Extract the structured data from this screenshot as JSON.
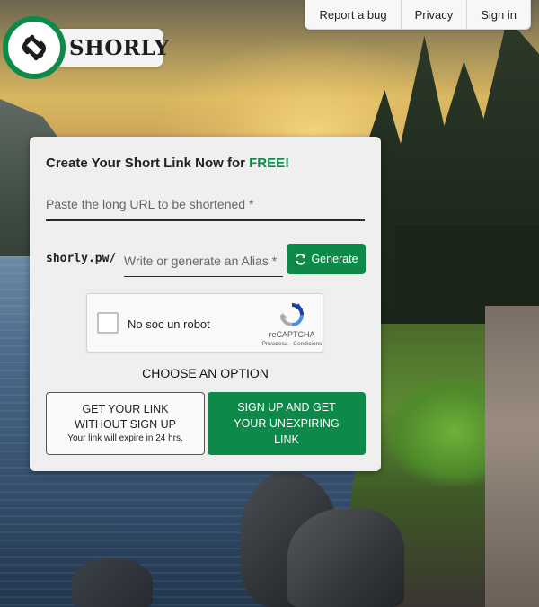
{
  "nav": {
    "report_bug": "Report a bug",
    "privacy": "Privacy",
    "sign_in": "Sign in"
  },
  "logo": {
    "text": "SHORLY",
    "icon": "chain-link-icon"
  },
  "card": {
    "title_prefix": "Create Your Short Link Now for ",
    "title_highlight": "FREE!",
    "url_placeholder": "Paste the long URL to be shortened *",
    "url_value": "",
    "alias_prefix": "shorly.pw/",
    "alias_placeholder": "Write or generate an Alias *",
    "alias_value": "",
    "generate_label": "Generate",
    "generate_icon": "refresh-icon",
    "choose_label": "CHOOSE AN OPTION",
    "option_free_line1": "GET YOUR LINK",
    "option_free_line2": "WITHOUT SIGN UP",
    "option_free_note": "Your link will expire in 24 hrs.",
    "option_signup_label": "SIGN UP AND GET YOUR UNEXPIRING LINK"
  },
  "recaptcha": {
    "label": "No soc un robot",
    "brand": "reCAPTCHA",
    "terms": "Privadesa - Condicions",
    "icon": "recaptcha-icon"
  },
  "colors": {
    "brand_green": "#0d8a4a",
    "card_bg": "#efefef"
  }
}
